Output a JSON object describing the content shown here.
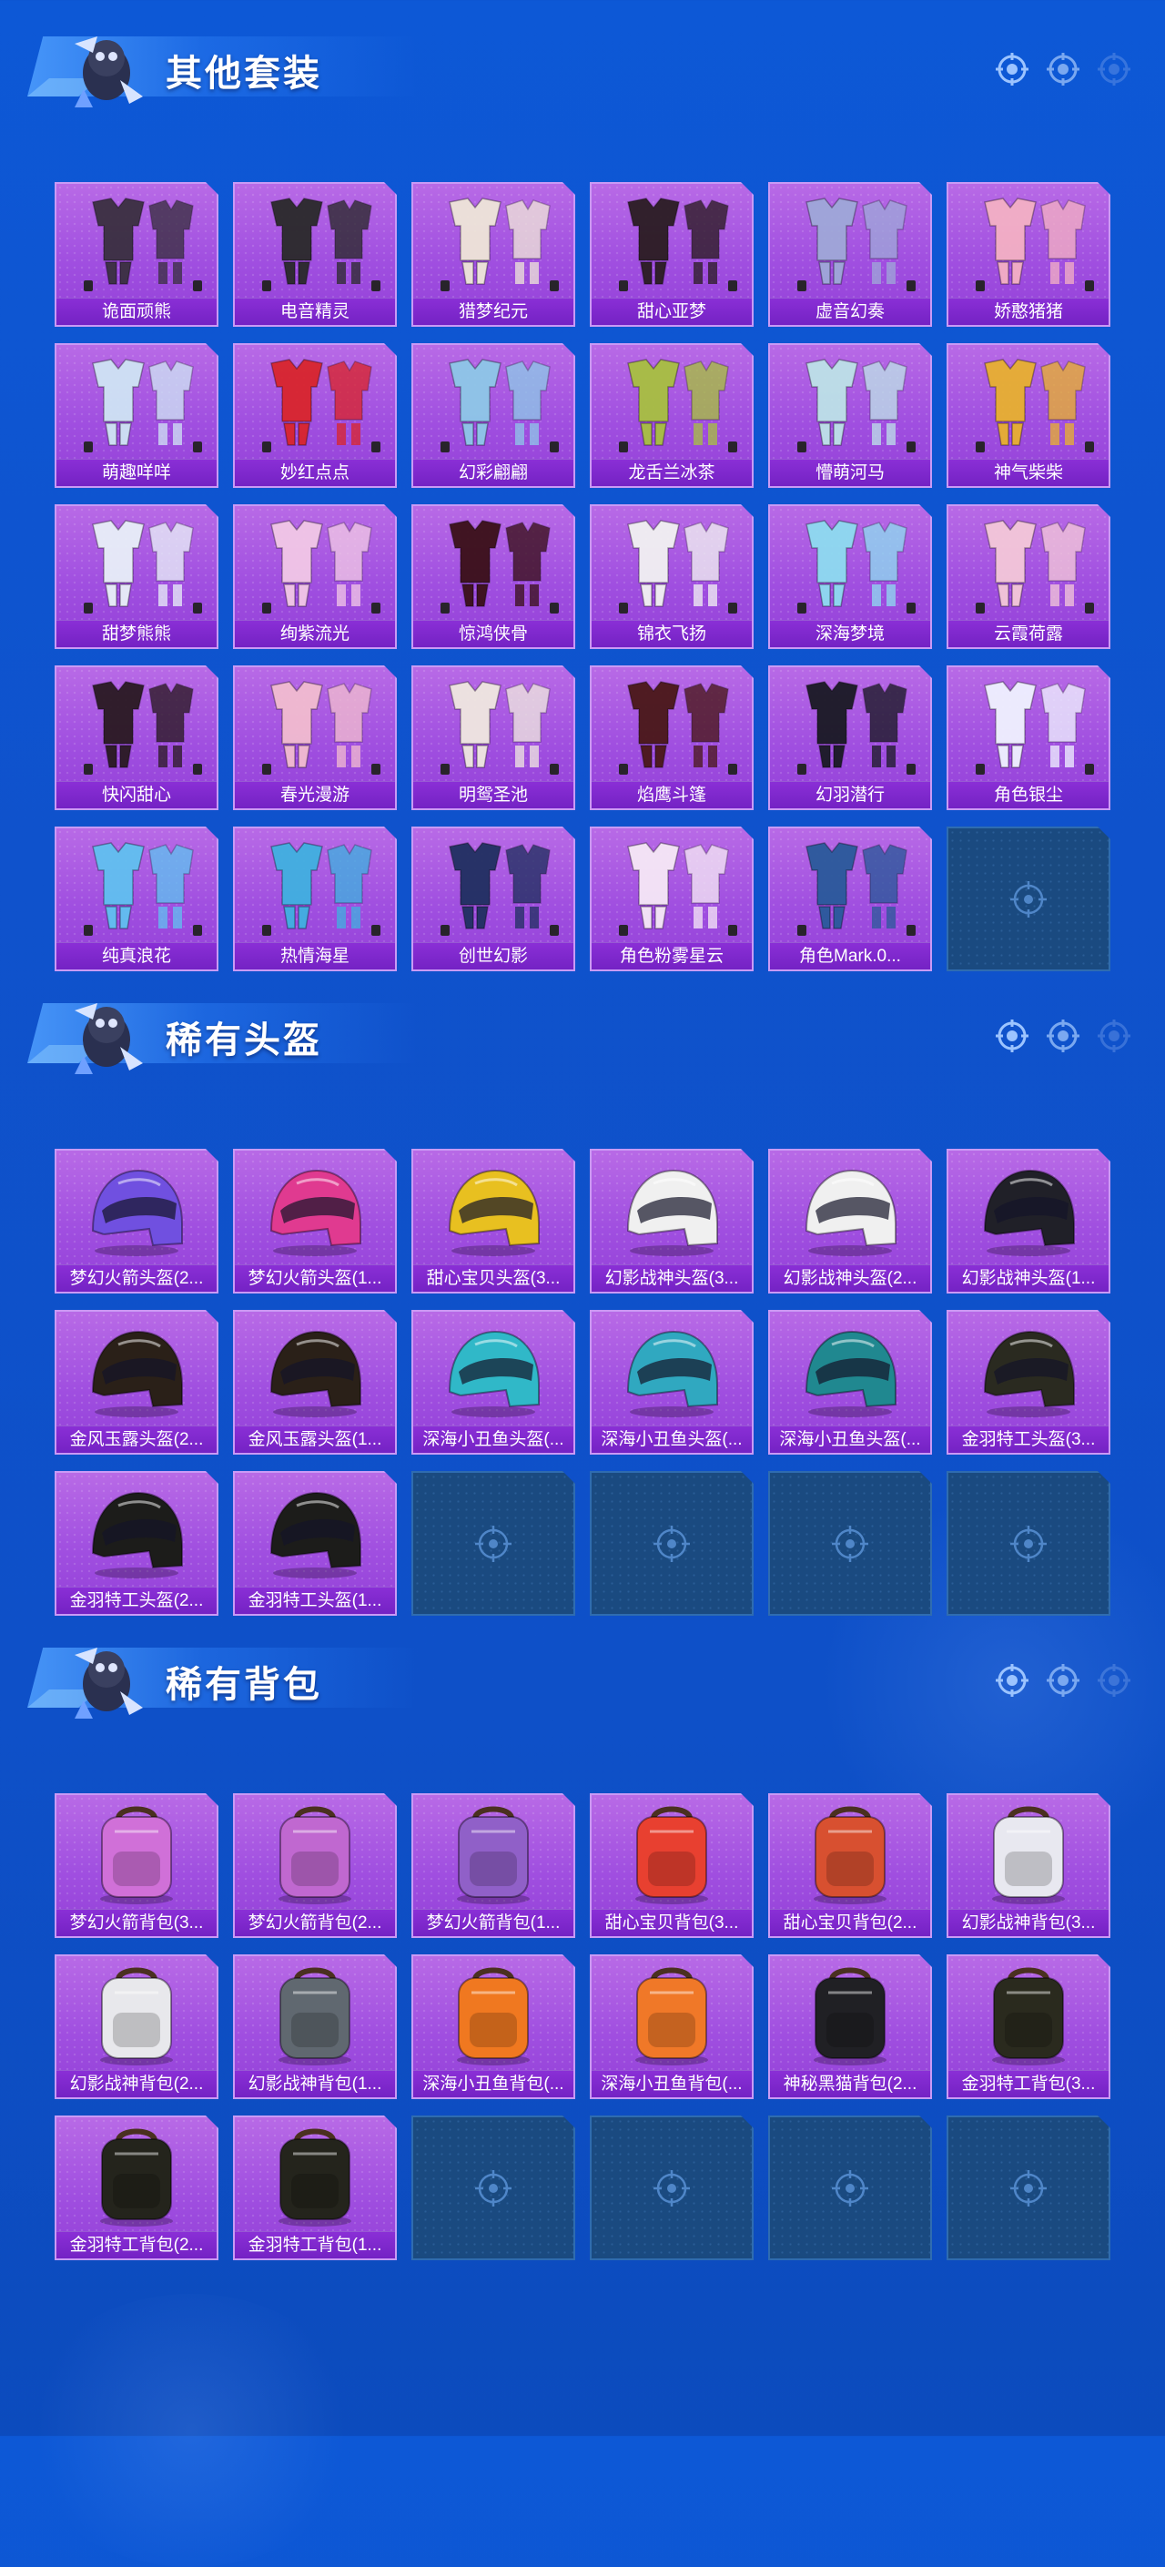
{
  "sections": [
    {
      "title": "其他套装",
      "kind": "outfit",
      "items": [
        "诡面顽熊",
        "电音精灵",
        "猎梦纪元",
        "甜心亚梦",
        "虚音幻奏",
        "娇憨猪猪",
        "萌趣咩咩",
        "妙红点点",
        "幻彩翩翩",
        "龙舌兰冰茶",
        "懵萌河马",
        "神气柴柴",
        "甜梦熊熊",
        "绚紫流光",
        "惊鸿侠骨",
        "锦衣飞扬",
        "深海梦境",
        "云霞荷露",
        "快闪甜心",
        "春光漫游",
        "明鸳圣池",
        "焰鹰斗篷",
        "幻羽潜行",
        "角色银尘",
        "纯真浪花",
        "热情海星",
        "创世幻影",
        "角色粉雾星云",
        "角色Mark.0..."
      ],
      "colors": [
        "#3a3040",
        "#2a2a2a",
        "#efe6d8",
        "#2b1d22",
        "#9fa8d8",
        "#f4b0c4",
        "#cfe4f4",
        "#d9252c",
        "#8ec8e8",
        "#a8c040",
        "#bde2e8",
        "#e8b030",
        "#e8f0f8",
        "#f2c8e6",
        "#3a1018",
        "#f2f2f2",
        "#8edcf0",
        "#f4c8d8",
        "#2a1a22",
        "#f2bcd0",
        "#f0e8e0",
        "#4a1818",
        "#1a1a24",
        "#f0f2ff",
        "#60c0f0",
        "#40b0e0",
        "#203060",
        "#f6e8f6",
        "#2a5a9a"
      ],
      "empty_slots": 1
    },
    {
      "title": "稀有头盔",
      "kind": "helmet",
      "items": [
        "梦幻火箭头盔(2...",
        "梦幻火箭头盔(1...",
        "甜心宝贝头盔(3...",
        "幻影战神头盔(3...",
        "幻影战神头盔(2...",
        "幻影战神头盔(1...",
        "金风玉露头盔(2...",
        "金风玉露头盔(1...",
        "深海小丑鱼头盔(...",
        "深海小丑鱼头盔(...",
        "深海小丑鱼头盔(...",
        "金羽特工头盔(3...",
        "金羽特工头盔(2...",
        "金羽特工头盔(1..."
      ],
      "colors": [
        "#7050e0",
        "#e03a90",
        "#e8c020",
        "#f0f0f0",
        "#f0f0f0",
        "#202028",
        "#2a2018",
        "#2a2018",
        "#30b8c8",
        "#30a8c0",
        "#208890",
        "#2a2a20",
        "#1c1c1a",
        "#1c1c1a"
      ],
      "empty_slots": 4
    },
    {
      "title": "稀有背包",
      "kind": "backpack",
      "items": [
        "梦幻火箭背包(3...",
        "梦幻火箭背包(2...",
        "梦幻火箭背包(1...",
        "甜心宝贝背包(3...",
        "甜心宝贝背包(2...",
        "幻影战神背包(3...",
        "幻影战神背包(2...",
        "幻影战神背包(1...",
        "深海小丑鱼背包(...",
        "深海小丑鱼背包(...",
        "神秘黑猫背包(2...",
        "金羽特工背包(3...",
        "金羽特工背包(2...",
        "金羽特工背包(1..."
      ],
      "colors": [
        "#d070d8",
        "#c068d0",
        "#9060c8",
        "#e84030",
        "#d85030",
        "#e8e8f0",
        "#e8e8ec",
        "#606870",
        "#f07820",
        "#f07828",
        "#202024",
        "#2a2a1e",
        "#24241c",
        "#24241c"
      ],
      "empty_slots": 4
    }
  ]
}
